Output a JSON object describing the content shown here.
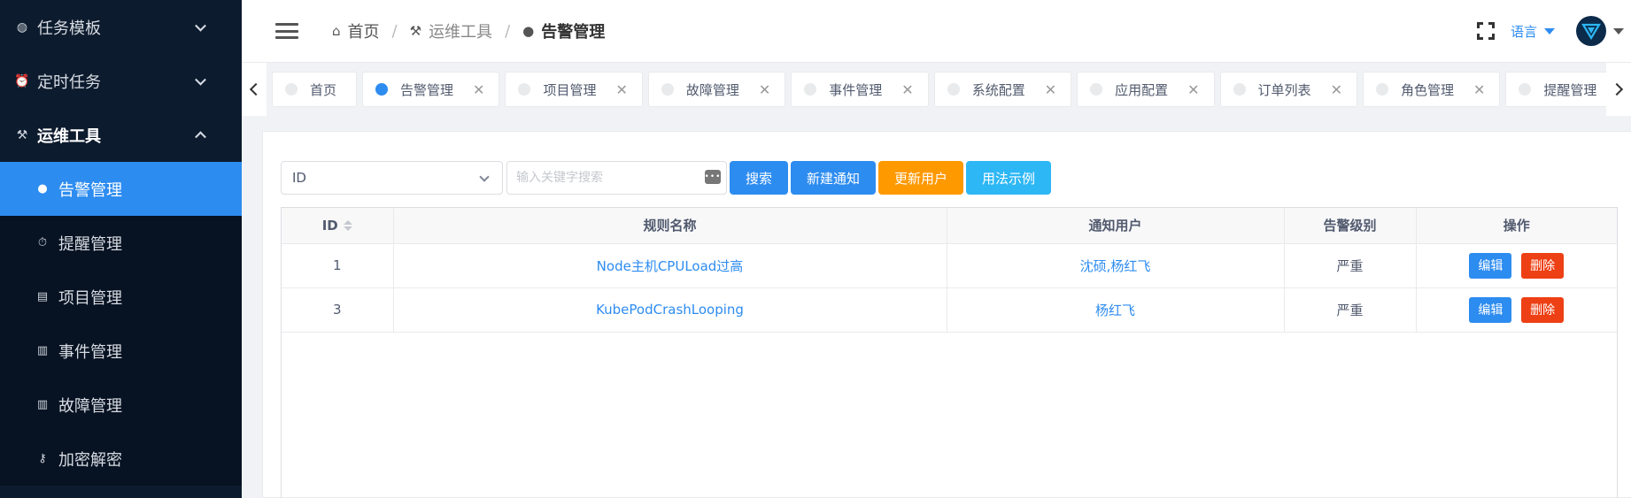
{
  "sidebar": {
    "groups": [
      {
        "label": "任务模板",
        "icon": "planet-icon"
      },
      {
        "label": "定时任务",
        "icon": "alarm-clock-icon"
      },
      {
        "label": "运维工具",
        "icon": "tools-icon"
      }
    ],
    "items": [
      {
        "label": "告警管理",
        "icon": "alert-circle-icon",
        "active": true
      },
      {
        "label": "提醒管理",
        "icon": "alarm-icon"
      },
      {
        "label": "项目管理",
        "icon": "document-icon"
      },
      {
        "label": "事件管理",
        "icon": "list-icon"
      },
      {
        "label": "故障管理",
        "icon": "list-icon"
      },
      {
        "label": "加密解密",
        "icon": "key-icon"
      }
    ]
  },
  "header": {
    "breadcrumb": [
      {
        "label": "首页",
        "icon": "home-icon"
      },
      {
        "label": "运维工具",
        "icon": "tools-icon"
      },
      {
        "label": "告警管理",
        "icon": "alert-circle-icon"
      }
    ],
    "language_label": "语言"
  },
  "tabs": [
    {
      "label": "首页",
      "closable": false
    },
    {
      "label": "告警管理",
      "active": true
    },
    {
      "label": "项目管理"
    },
    {
      "label": "故障管理"
    },
    {
      "label": "事件管理"
    },
    {
      "label": "系统配置"
    },
    {
      "label": "应用配置"
    },
    {
      "label": "订单列表"
    },
    {
      "label": "角色管理"
    },
    {
      "label": "提醒管理"
    }
  ],
  "toolbar": {
    "select_value": "ID",
    "search_placeholder": "输入关键字搜索",
    "search_button": "搜索",
    "new_notice_button": "新建通知",
    "update_user_button": "更新用户",
    "usage_example_button": "用法示例"
  },
  "table": {
    "columns": [
      "ID",
      "规则名称",
      "通知用户",
      "告警级别",
      "操作"
    ],
    "rows": [
      {
        "id": "1",
        "rule_name": "Node主机CPULoad过高",
        "users": "沈硕,杨红飞",
        "level": "严重"
      },
      {
        "id": "3",
        "rule_name": "KubePodCrashLooping",
        "users": "杨红飞",
        "level": "严重"
      }
    ],
    "edit_label": "编辑",
    "delete_label": "删除"
  },
  "colors": {
    "sidebar_bg": "#0d1b2e",
    "primary": "#2d8cf0",
    "warning": "#ff9900",
    "info": "#2db7f5",
    "error": "#ed4014"
  }
}
